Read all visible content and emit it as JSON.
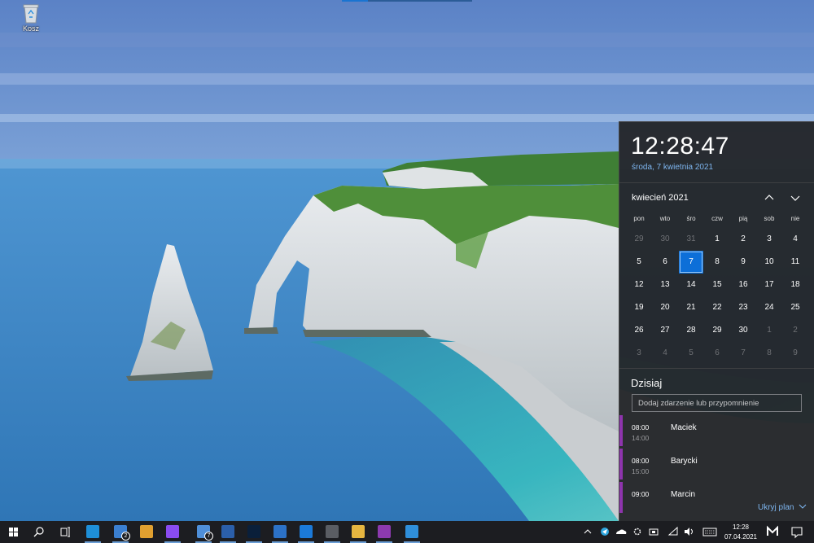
{
  "desktop": {
    "recycle_bin_label": "Kosz"
  },
  "flyout": {
    "clock": "12:28:47",
    "full_date": "środa, 7 kwietnia 2021",
    "month_label": "kwiecień 2021",
    "weekdays": [
      "pon",
      "wto",
      "śro",
      "czw",
      "pią",
      "sob",
      "nie"
    ],
    "days": [
      {
        "d": "29",
        "cur": false
      },
      {
        "d": "30",
        "cur": false
      },
      {
        "d": "31",
        "cur": false
      },
      {
        "d": "1",
        "cur": true
      },
      {
        "d": "2",
        "cur": true
      },
      {
        "d": "3",
        "cur": true
      },
      {
        "d": "4",
        "cur": true
      },
      {
        "d": "5",
        "cur": true
      },
      {
        "d": "6",
        "cur": true
      },
      {
        "d": "7",
        "cur": true,
        "today": true
      },
      {
        "d": "8",
        "cur": true
      },
      {
        "d": "9",
        "cur": true
      },
      {
        "d": "10",
        "cur": true
      },
      {
        "d": "11",
        "cur": true
      },
      {
        "d": "12",
        "cur": true
      },
      {
        "d": "13",
        "cur": true
      },
      {
        "d": "14",
        "cur": true
      },
      {
        "d": "15",
        "cur": true
      },
      {
        "d": "16",
        "cur": true
      },
      {
        "d": "17",
        "cur": true
      },
      {
        "d": "18",
        "cur": true
      },
      {
        "d": "19",
        "cur": true
      },
      {
        "d": "20",
        "cur": true
      },
      {
        "d": "21",
        "cur": true
      },
      {
        "d": "22",
        "cur": true
      },
      {
        "d": "23",
        "cur": true
      },
      {
        "d": "24",
        "cur": true
      },
      {
        "d": "25",
        "cur": true
      },
      {
        "d": "26",
        "cur": true
      },
      {
        "d": "27",
        "cur": true
      },
      {
        "d": "28",
        "cur": true
      },
      {
        "d": "29",
        "cur": true
      },
      {
        "d": "30",
        "cur": true
      },
      {
        "d": "1",
        "cur": false
      },
      {
        "d": "2",
        "cur": false
      },
      {
        "d": "3",
        "cur": false
      },
      {
        "d": "4",
        "cur": false
      },
      {
        "d": "5",
        "cur": false
      },
      {
        "d": "6",
        "cur": false
      },
      {
        "d": "7",
        "cur": false
      },
      {
        "d": "8",
        "cur": false
      },
      {
        "d": "9",
        "cur": false
      }
    ],
    "agenda_title": "Dzisiaj",
    "event_placeholder": "Dodaj zdarzenie lub przypomnienie",
    "events": [
      {
        "start": "08:00",
        "end": "14:00",
        "name": "Maciek"
      },
      {
        "start": "08:00",
        "end": "15:00",
        "name": "Barycki"
      },
      {
        "start": "09:00",
        "end": "",
        "name": "Marcin"
      }
    ],
    "hide_plan": "Ukryj plan",
    "event_color": "#8e34ad",
    "accent": "#0d6fd8"
  },
  "taskbar": {
    "mail_badge": "2",
    "notes_badge": "7",
    "tray_time": "12:28",
    "tray_date": "07.04.2021",
    "apps": [
      {
        "name": "edge-icon",
        "color": "#1e8fd8"
      },
      {
        "name": "mail-icon",
        "color": "#3b7fd0"
      },
      {
        "name": "slack-icon",
        "color": "#e0a030"
      },
      {
        "name": "messenger-icon",
        "color": "#8a4cf0"
      },
      {
        "name": "notes-icon",
        "color": "#4f8fd8"
      },
      {
        "name": "word-icon",
        "color": "#2b5faa"
      },
      {
        "name": "photoshop-icon",
        "color": "#0a1f3a"
      },
      {
        "name": "outlook-icon",
        "color": "#2c72c7"
      },
      {
        "name": "trello-icon",
        "color": "#1b7ad9"
      },
      {
        "name": "calculator-icon",
        "color": "#5a5d63"
      },
      {
        "name": "file-explorer-icon",
        "color": "#e6b640"
      },
      {
        "name": "onenote-icon",
        "color": "#8c3aaf"
      },
      {
        "name": "photos-icon",
        "color": "#2f8fdb"
      }
    ]
  }
}
